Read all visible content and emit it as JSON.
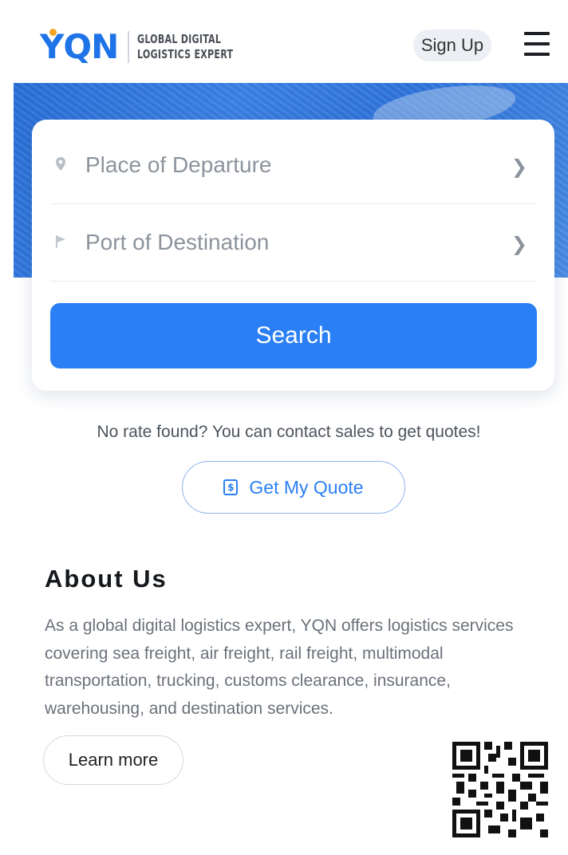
{
  "header": {
    "logo_text": "YQN",
    "tagline_line1": "GLOBAL DIGITAL",
    "tagline_line2": "LOGISTICS EXPERT",
    "signup_label": "Sign Up"
  },
  "search_form": {
    "departure_placeholder": "Place of Departure",
    "destination_placeholder": "Port of Destination",
    "search_label": "Search"
  },
  "quote": {
    "notice": "No rate found? You can contact sales to get quotes!",
    "button_label": "Get My Quote"
  },
  "about": {
    "title": "About Us",
    "text": "As a global digital logistics expert, YQN offers logistics services covering sea freight, air freight, rail freight, multimodal transportation, trucking, customs clearance, insurance, warehousing, and destination services.",
    "learn_more_label": "Learn more"
  },
  "colors": {
    "brand_blue": "#2b7ff5",
    "logo_dot": "#f5a623"
  },
  "icons": [
    "location-pin-icon",
    "flag-icon",
    "chevron-right-icon",
    "quote-dollar-icon",
    "hamburger-menu-icon",
    "qr-code-icon"
  ]
}
